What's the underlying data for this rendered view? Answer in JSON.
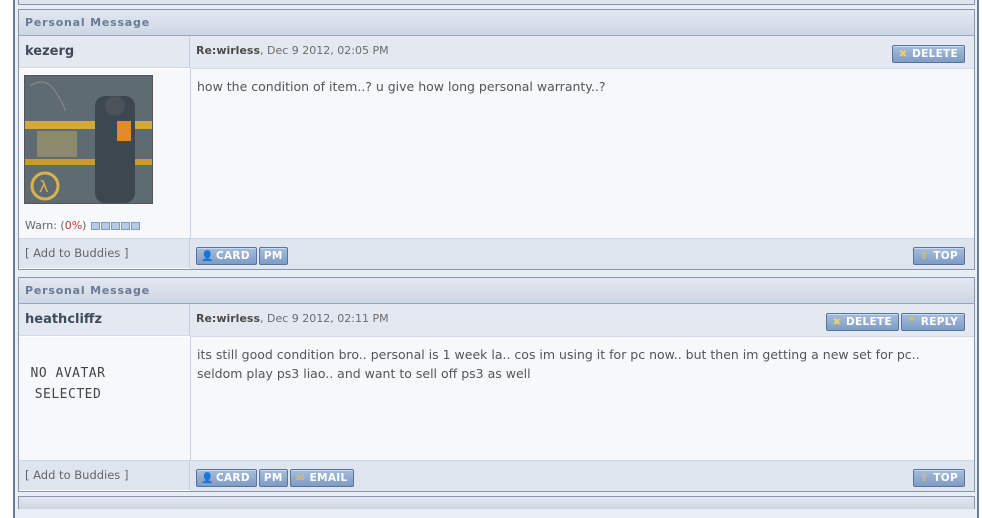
{
  "posts": [
    {
      "header": "Personal Message",
      "username": "kezerg",
      "title": "Re:wirless",
      "date": ", Dec 9 2012, 02:05 PM",
      "delete_label": "DELETE",
      "body_lines": [
        "how the condition of item..? u give how long personal warranty..?"
      ],
      "warn_label": "Warn: (",
      "warn_pct": "0%",
      "warn_close": ")",
      "add_buddies": "[ Add to Buddies ]",
      "card_label": "CARD",
      "pm_label": "PM",
      "top_label": "TOP"
    },
    {
      "header": "Personal Message",
      "username": "heathcliffz",
      "title": "Re:wirless",
      "date": ", Dec 9 2012, 02:11 PM",
      "delete_label": "DELETE",
      "reply_label": "REPLY",
      "noavatar_line1": "NO AVATAR",
      "noavatar_line2": "SELECTED",
      "body_lines": [
        "its still good condition bro.. personal is 1 week la.. cos im using it for pc now.. but then im getting a new set for pc..",
        "seldom play ps3 liao.. and want to sell off ps3 as well"
      ],
      "add_buddies": "[ Add to Buddies ]",
      "card_label": "CARD",
      "pm_label": "PM",
      "email_label": "EMAIL",
      "top_label": "TOP"
    }
  ],
  "icons": {
    "delete": "x-icon",
    "reply": "quote-icon",
    "card": "user-icon",
    "email": "envelope-icon",
    "top": "arrow-up-icon"
  }
}
